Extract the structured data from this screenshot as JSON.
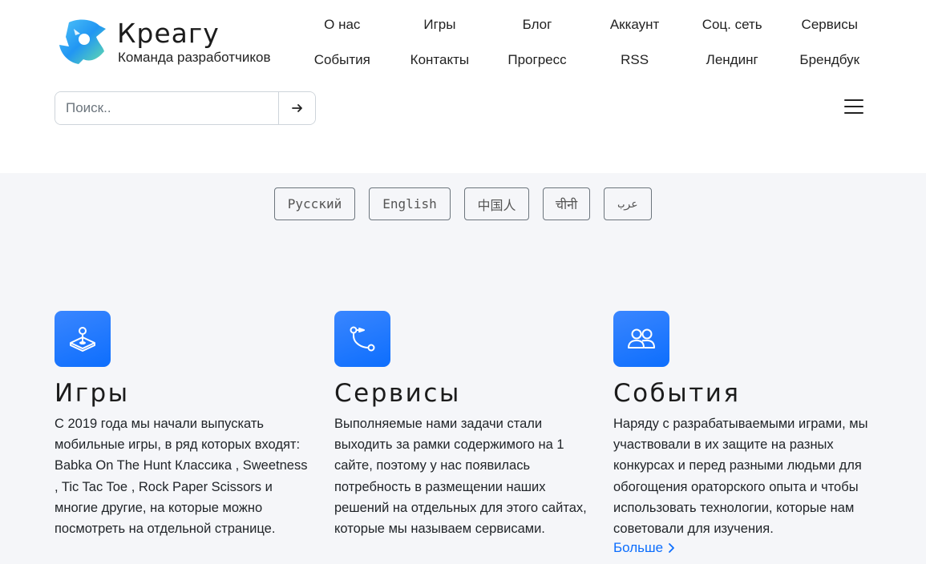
{
  "brand": {
    "name": "Креагу",
    "subtitle": "Команда разработчиков"
  },
  "nav": {
    "row1": [
      "О нас",
      "Игры",
      "Блог",
      "Аккаунт",
      "Соц. сеть",
      "Сервисы"
    ],
    "row2": [
      "События",
      "Контакты",
      "Прогресс",
      "RSS",
      "Лендинг",
      "Брендбук"
    ]
  },
  "search": {
    "placeholder": "Поиск..",
    "value": ""
  },
  "languages": [
    "Русский",
    "English",
    "中国人",
    "चीनी",
    "عرب"
  ],
  "features": [
    {
      "icon": "joystick-icon",
      "title": "Игры",
      "text": "С 2019 года мы начали выпускать мобильные игры, в ряд которых входят: Babka On The Hunt Классика , Sweetness , Tic Tac Toe , Rock Paper Scissors и многие другие, на которые можно посмотреть на отдельной странице."
    },
    {
      "icon": "vector-path-icon",
      "title": "Сервисы",
      "text": "Выполняемые нами задачи стали выходить за рамки содержимого на 1 сайте, поэтому у нас появилась потребность в размещении наших решений на отдельных для этого сайтах, которые мы называем сервисами."
    },
    {
      "icon": "people-icon",
      "title": "События",
      "text": "Наряду с разрабатываемыми играми, мы участвовали в их защите на разных конкурсах и перед разными людьми для обогощения ораторского опыта и чтобы использовать технологии, которые нам советовали для изучения.",
      "link": "Больше"
    }
  ],
  "colors": {
    "accent": "#0d6efd",
    "section_bg": "#f5f6f9",
    "text": "#212529"
  }
}
